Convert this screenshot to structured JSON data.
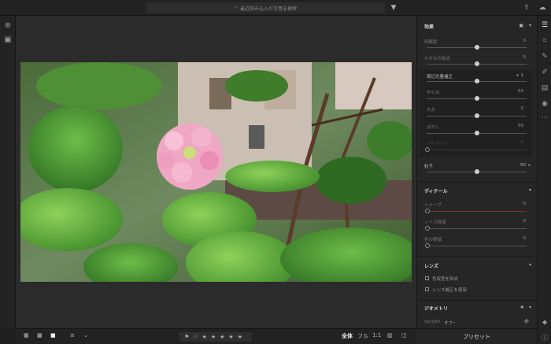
{
  "search": {
    "placeholder": "最近読み込んだ写真を検索"
  },
  "icons": {
    "search": "search-icon",
    "filter": "filter-icon",
    "share": "share-icon",
    "cloud": "cloud-icon",
    "add": "add-icon",
    "library": "library-icon"
  },
  "bottom": {
    "fit": "全体",
    "fill": "フル",
    "ratio": "1:1"
  },
  "effects": {
    "title": "効果",
    "rows": [
      {
        "label": "明瞭度",
        "value": "0",
        "pos": 0.5
      },
      {
        "label": "かすみの除去",
        "value": "0",
        "pos": 0.5
      }
    ],
    "vignette": {
      "title": "周辺光量補正",
      "value": "+ 1",
      "pos": 0.5,
      "rows": [
        {
          "label": "中心点",
          "value": "50",
          "pos": 0.5
        },
        {
          "label": "丸み",
          "value": "0",
          "pos": 0.5
        },
        {
          "label": "ぼかし",
          "value": "50",
          "pos": 0.5
        },
        {
          "label": "ハイライト",
          "value": "0",
          "pos": 0.0
        }
      ]
    },
    "grain": {
      "label": "粒子",
      "value": "50",
      "pos": 0.5
    }
  },
  "detail": {
    "title": "ディテール",
    "rows": [
      {
        "label": "シャープ",
        "value": "0",
        "pos": 0.0
      },
      {
        "label": "ノイズ軽減",
        "value": "0",
        "pos": 0.0
      },
      {
        "label": "色の軽減",
        "value": "0",
        "pos": 0.0
      }
    ]
  },
  "lens": {
    "title": "レンズ",
    "options": [
      "色収差を除去",
      "レンズ補正を使用"
    ]
  },
  "geometry": {
    "title": "ジオメトリ",
    "upright_label": "Upright",
    "upright_value": "オフ"
  },
  "preset_label": "プリセット",
  "colors": {
    "accent_red": "#b04040",
    "panel_bg": "#262626"
  }
}
